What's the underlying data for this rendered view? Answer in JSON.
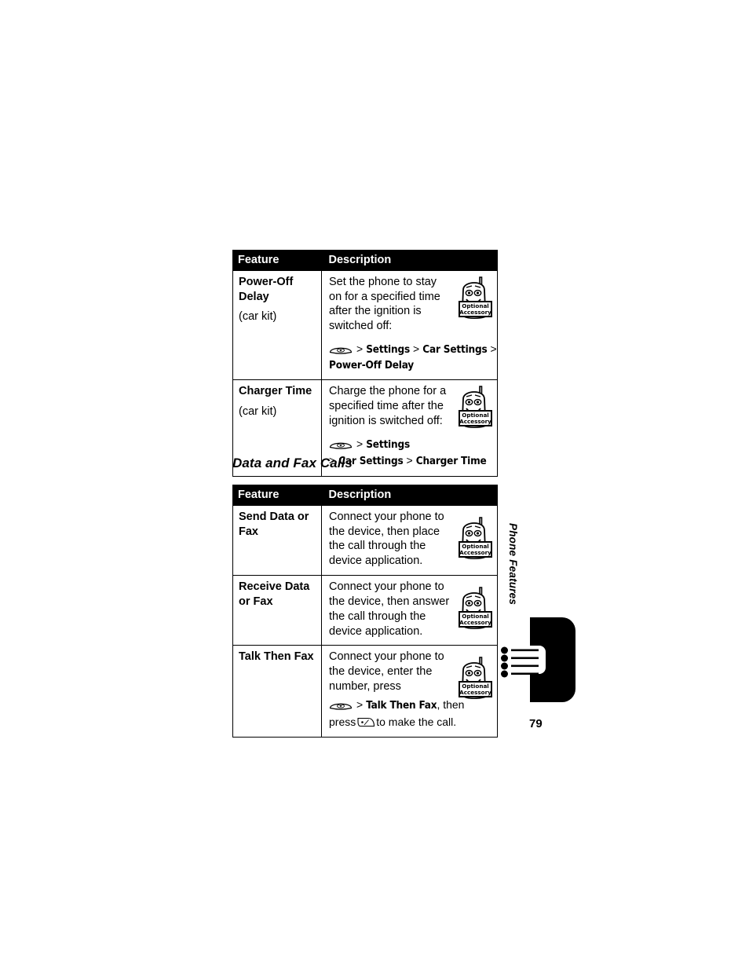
{
  "page": {
    "number": "79",
    "side_tab_label": "Phone Features"
  },
  "icons": {
    "menu_key": "menu-key-icon",
    "send_key": "send-key-icon",
    "optional_accessory": "optional-accessory-icon",
    "optional_accessory_line1": "Optional",
    "optional_accessory_line2": "Accessory"
  },
  "tables": [
    {
      "headers": [
        "Feature",
        "Description"
      ],
      "rows": [
        {
          "feature": "Power-Off Delay",
          "feature_note": "(car kit)",
          "description_lines": [
            "Set the phone to stay",
            "on for a specified time",
            "after the ignition is",
            "switched off:"
          ],
          "nav_path": [
            "Settings",
            "Car Settings",
            "Power-Off Delay"
          ],
          "has_menu_key": true,
          "has_accessory": true
        },
        {
          "feature": "Charger Time",
          "feature_note": "(car kit)",
          "description_lines": [
            "Charge the phone for a",
            "specified time after the",
            "ignition is switched off:"
          ],
          "nav_path": [
            "Settings",
            "Car Settings",
            "Charger Time"
          ],
          "has_menu_key": true,
          "has_accessory": true
        }
      ]
    },
    {
      "headers": [
        "Feature",
        "Description"
      ],
      "rows": [
        {
          "feature": "Send Data or Fax",
          "feature_note": "",
          "description_lines": [
            "Connect your phone to",
            "the device, then place",
            "the call through the",
            "device application."
          ],
          "nav_path": [],
          "has_menu_key": false,
          "has_accessory": true
        },
        {
          "feature": "Receive Data or Fax",
          "feature_note": "",
          "description_lines": [
            "Connect your phone to",
            "the device, then answer",
            "the call through the",
            "device application."
          ],
          "nav_path": [],
          "has_menu_key": false,
          "has_accessory": true
        },
        {
          "feature": "Talk Then Fax",
          "feature_note": "",
          "description_lines": [
            "Connect your phone to",
            "the device, enter the",
            "number, press"
          ],
          "nav_path": [
            "Talk Then Fax"
          ],
          "nav_suffix": ", then",
          "trailer_prefix": "press",
          "trailer_suffix": "to make the call.",
          "has_menu_key": true,
          "has_send_key": true,
          "has_accessory": true
        }
      ]
    }
  ],
  "section_heading": "Data and Fax Calls"
}
